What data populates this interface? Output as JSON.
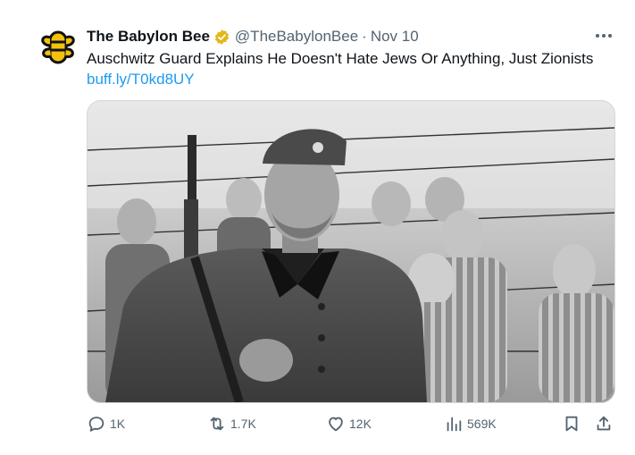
{
  "tweet": {
    "author_name": "The Babylon Bee",
    "handle": "@TheBabylonBee",
    "separator": "·",
    "date": "Nov 10",
    "text": "Auschwitz Guard Explains He Doesn't Hate Jews Or Anything, Just Zionists",
    "link": "buff.ly/T0kd8UY"
  },
  "actions": {
    "replies": "1K",
    "reposts": "1.7K",
    "likes": "12K",
    "views": "569K"
  },
  "colors": {
    "text": "#0f1419",
    "secondary": "#536471",
    "link": "#1d9bf0",
    "verified": "#e2b719"
  },
  "icons": {
    "avatar": "bee-logo-icon",
    "verified": "verified-badge-icon",
    "more": "more-dots-icon",
    "reply": "reply-icon",
    "repost": "repost-icon",
    "like": "heart-icon",
    "views": "views-chart-icon",
    "bookmark": "bookmark-icon",
    "share": "share-icon"
  }
}
